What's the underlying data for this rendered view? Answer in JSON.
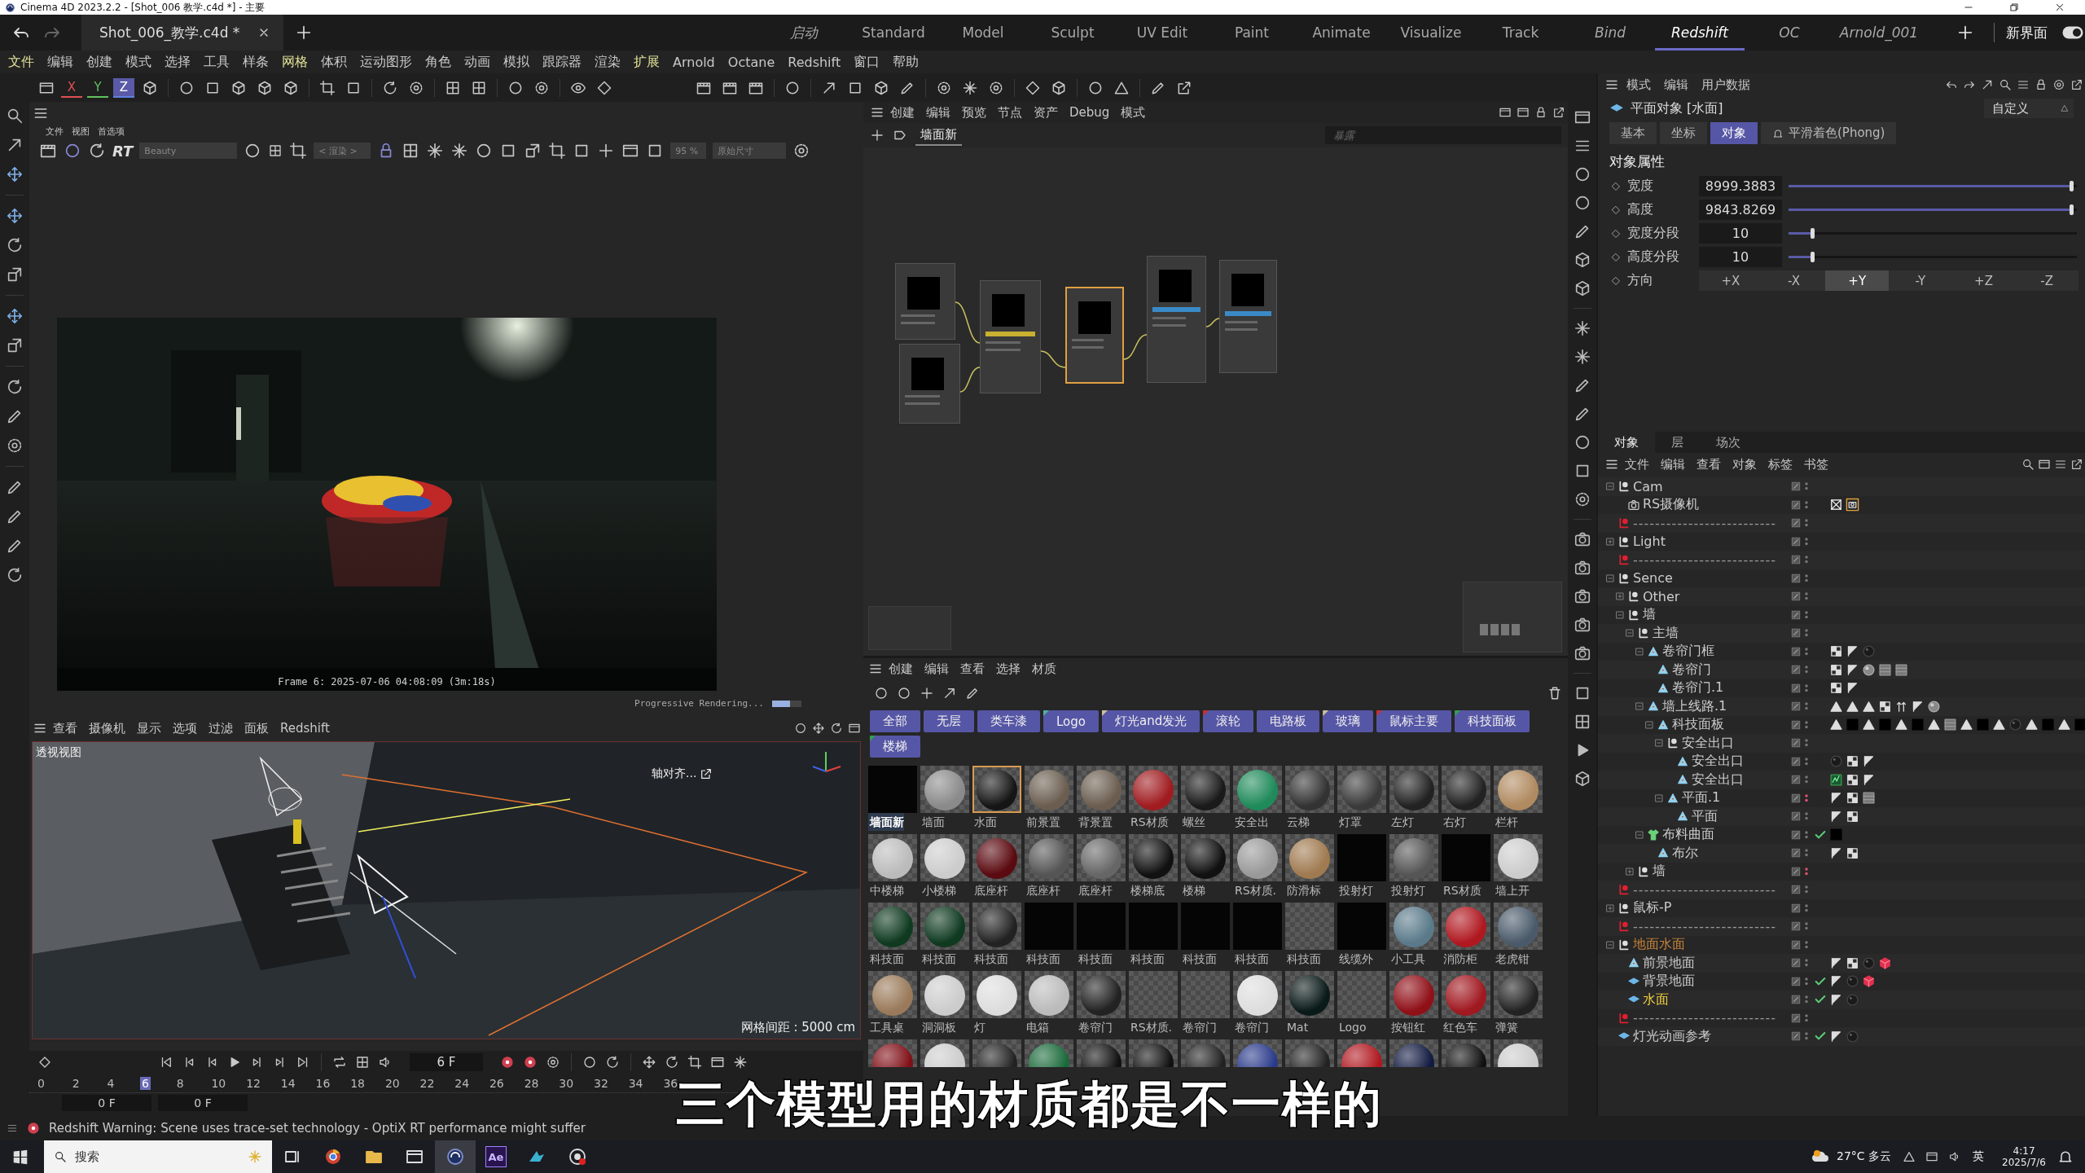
{
  "title_bar": {
    "title": "Cinema 4D 2023.2.2 - [Shot_006 教学.c4d *] - 主要"
  },
  "document_tab": {
    "label": "Shot_006_教学.c4d *"
  },
  "layouts": [
    {
      "label": "启动",
      "custom": true,
      "selected": false
    },
    {
      "label": "Standard",
      "custom": false,
      "selected": false
    },
    {
      "label": "Model",
      "custom": false,
      "selected": false
    },
    {
      "label": "Sculpt",
      "custom": false,
      "selected": false
    },
    {
      "label": "UV Edit",
      "custom": false,
      "selected": false
    },
    {
      "label": "Paint",
      "custom": false,
      "selected": false
    },
    {
      "label": "Animate",
      "custom": false,
      "selected": false
    },
    {
      "label": "Visualize",
      "custom": false,
      "selected": false
    },
    {
      "label": "Track",
      "custom": false,
      "selected": false
    },
    {
      "label": "Bind",
      "custom": true,
      "selected": false
    },
    {
      "label": "Redshift",
      "custom": true,
      "selected": true
    },
    {
      "label": "OC",
      "custom": true,
      "selected": false
    },
    {
      "label": "Arnold_001",
      "custom": true,
      "selected": false
    }
  ],
  "new_layout": "新界面",
  "menu": [
    {
      "label": "文件",
      "highlighted": true
    },
    {
      "label": "编辑",
      "highlighted": false
    },
    {
      "label": "创建",
      "highlighted": false
    },
    {
      "label": "模式",
      "highlighted": false
    },
    {
      "label": "选择",
      "highlighted": false
    },
    {
      "label": "工具",
      "highlighted": false
    },
    {
      "label": "样条",
      "highlighted": false
    },
    {
      "label": "网格",
      "highlighted": true
    },
    {
      "label": "体积",
      "highlighted": false
    },
    {
      "label": "运动图形",
      "highlighted": false
    },
    {
      "label": "角色",
      "highlighted": false
    },
    {
      "label": "动画",
      "highlighted": false
    },
    {
      "label": "模拟",
      "highlighted": false
    },
    {
      "label": "跟踪器",
      "highlighted": false
    },
    {
      "label": "渲染",
      "highlighted": false
    },
    {
      "label": "扩展",
      "highlighted": true
    },
    {
      "label": "Arnold",
      "highlighted": false
    },
    {
      "label": "Octane",
      "highlighted": false
    },
    {
      "label": "Redshift",
      "highlighted": false
    },
    {
      "label": "窗口",
      "highlighted": false
    },
    {
      "label": "帮助",
      "highlighted": false
    }
  ],
  "axis_buttons": [
    {
      "label": "X",
      "selected": false
    },
    {
      "label": "Y",
      "selected": false
    },
    {
      "label": "Z",
      "selected": true
    }
  ],
  "render_view": {
    "menu": [
      "文件",
      "视图",
      "首选项"
    ],
    "rt": "RT",
    "pass": "Beauty",
    "mode": "< 渲染 >",
    "zoom": "95 %",
    "size": "原始尺寸",
    "caption": "Frame 6: 2025-07-06 04:08:09 (3m:18s)",
    "progress_text": "Progressive Rendering...",
    "progress": {
      "level": 0.6
    }
  },
  "viewport": {
    "menu": [
      "查看",
      "摄像机",
      "显示",
      "选项",
      "过滤",
      "面板",
      "Redshift"
    ],
    "view_name": "透视视图",
    "align": "轴对齐...",
    "grid_spacing": "网格间距 : 5000 cm"
  },
  "timeline": {
    "current_frame": "6 F",
    "ruler": [
      {
        "label": "0",
        "selected": false
      },
      {
        "label": "2",
        "selected": false
      },
      {
        "label": "4",
        "selected": false
      },
      {
        "label": "6",
        "selected": true
      },
      {
        "label": "8",
        "selected": false
      },
      {
        "label": "10",
        "selected": false
      },
      {
        "label": "12",
        "selected": false
      },
      {
        "label": "14",
        "selected": false
      },
      {
        "label": "16",
        "selected": false
      },
      {
        "label": "18",
        "selected": false
      },
      {
        "label": "20",
        "selected": false
      },
      {
        "label": "22",
        "selected": false
      },
      {
        "label": "24",
        "selected": false
      },
      {
        "label": "26",
        "selected": false
      },
      {
        "label": "28",
        "selected": false
      },
      {
        "label": "30",
        "selected": false
      },
      {
        "label": "32",
        "selected": false
      },
      {
        "label": "34",
        "selected": false
      },
      {
        "label": "36",
        "selected": false
      }
    ],
    "start": "0 F",
    "end": "0 F"
  },
  "node_editor": {
    "menu": [
      "创建",
      "编辑",
      "预览",
      "节点",
      "资产",
      "Debug",
      "模式"
    ],
    "tab": "墙面新",
    "search": {
      "placeholder": "暴露"
    },
    "nodes": [
      {
        "selected": false
      },
      {
        "selected": false
      },
      {
        "selected": false,
        "color": "#c8b030"
      },
      {
        "selected": true
      },
      {
        "selected": false,
        "color": "#3a8ac8"
      },
      {
        "selected": false,
        "color": "#3a8ac8"
      }
    ]
  },
  "material_manager": {
    "menu": [
      "创建",
      "编辑",
      "查看",
      "选择",
      "材质"
    ],
    "tags": [
      {
        "label": "全部"
      },
      {
        "label": "无层"
      },
      {
        "label": "类车漆"
      },
      {
        "label": "Logo",
        "color": "#4fb0a0"
      },
      {
        "label": "灯光and发光",
        "color": "#c8c0a0"
      },
      {
        "label": "滚轮",
        "color": "#c83030"
      },
      {
        "label": "电路板"
      },
      {
        "label": "玻璃",
        "color": "#c8c0a0"
      },
      {
        "label": "鼠标主要",
        "color": "#c83030"
      },
      {
        "label": "科技面板",
        "color": "#30a050"
      },
      {
        "label": "楼梯",
        "color": "#30a050"
      }
    ],
    "materials": [
      {
        "label": "墙面新",
        "kind": "flat",
        "selected": false,
        "active": true
      },
      {
        "label": "墙面",
        "kind": "sphere",
        "color": "#8a8a8a",
        "selected": false,
        "active": false
      },
      {
        "label": "水面",
        "kind": "sphere",
        "color": "#151515",
        "selected": true,
        "active": false
      },
      {
        "label": "前景置",
        "kind": "sphere",
        "color": "#6b5e50",
        "selected": false,
        "active": false
      },
      {
        "label": "背景置",
        "kind": "sphere",
        "color": "#6b5e50",
        "selected": false,
        "active": false
      },
      {
        "label": "RS材质",
        "kind": "sphere",
        "color": "#a01c20",
        "selected": false,
        "active": false
      },
      {
        "label": "螺丝",
        "kind": "sphere",
        "color": "#1a1a1a",
        "selected": false,
        "active": false
      },
      {
        "label": "安全出",
        "kind": "sphere",
        "color": "#1f8a5a",
        "selected": false,
        "active": false
      },
      {
        "label": "云梯",
        "kind": "sphere",
        "color": "#333333",
        "selected": false,
        "active": false
      },
      {
        "label": "灯罩",
        "kind": "sphere",
        "color": "#3a3a3a",
        "selected": false,
        "active": false
      },
      {
        "label": "左灯",
        "kind": "sphere",
        "color": "#222222",
        "selected": false,
        "active": false
      },
      {
        "label": "右灯",
        "kind": "sphere",
        "color": "#222222",
        "selected": false,
        "active": false
      },
      {
        "label": "栏杆",
        "kind": "sphere",
        "color": "#b08a60",
        "selected": false,
        "active": false
      },
      {
        "label": "中楼梯",
        "kind": "sphere",
        "color": "#bbbbbb",
        "selected": false,
        "active": false
      },
      {
        "label": "小楼梯",
        "kind": "sphere",
        "color": "#cccccc",
        "selected": false,
        "active": false
      },
      {
        "label": "底座杆",
        "kind": "sphere",
        "color": "#5a0a10",
        "selected": false,
        "active": false
      },
      {
        "label": "底座杆",
        "kind": "sphere",
        "color": "#555555",
        "selected": false,
        "active": false
      },
      {
        "label": "底座杆",
        "kind": "sphere",
        "color": "#666666",
        "selected": false,
        "active": false
      },
      {
        "label": "楼梯底",
        "kind": "sphere",
        "color": "#111111",
        "selected": false,
        "active": false
      },
      {
        "label": "楼梯",
        "kind": "sphere",
        "color": "#111111",
        "selected": false,
        "active": false
      },
      {
        "label": "RS材质.",
        "kind": "sphere",
        "color": "#999999",
        "selected": false,
        "active": false
      },
      {
        "label": "防滑标",
        "kind": "sphere",
        "color": "#a07a50",
        "selected": false,
        "active": false
      },
      {
        "label": "投射灯",
        "kind": "flat",
        "selected": false,
        "active": false
      },
      {
        "label": "投射灯",
        "kind": "sphere",
        "color": "#555555",
        "selected": false,
        "active": false
      },
      {
        "label": "RS材质",
        "kind": "flat",
        "selected": false,
        "active": false
      },
      {
        "label": "墙上开",
        "kind": "sphere",
        "color": "#cccccc",
        "selected": false,
        "active": false
      },
      {
        "label": "科技面",
        "kind": "sphere",
        "color": "#0f3a20",
        "selected": false,
        "active": false
      },
      {
        "label": "科技面",
        "kind": "sphere",
        "color": "#0f3a20",
        "selected": false,
        "active": false
      },
      {
        "label": "科技面",
        "kind": "sphere",
        "color": "#222222",
        "selected": false,
        "active": false
      },
      {
        "label": "科技面",
        "kind": "flat",
        "selected": false,
        "active": false
      },
      {
        "label": "科技面",
        "kind": "flat",
        "selected": false,
        "active": false
      },
      {
        "label": "科技面",
        "kind": "flat",
        "selected": false,
        "active": false
      },
      {
        "label": "科技面",
        "kind": "flat",
        "selected": false,
        "active": false
      },
      {
        "label": "科技面",
        "kind": "flat",
        "selected": false,
        "active": false
      },
      {
        "label": "科技面",
        "kind": "empty",
        "selected": false,
        "active": false
      },
      {
        "label": "线缆外",
        "kind": "flat",
        "selected": false,
        "active": false
      },
      {
        "label": "小工具",
        "kind": "sphere",
        "color": "#5a7a8a",
        "selected": false,
        "active": false
      },
      {
        "label": "消防柜",
        "kind": "sphere",
        "color": "#b01820",
        "selected": false,
        "active": false
      },
      {
        "label": "老虎钳",
        "kind": "sphere",
        "color": "#4a5a6a",
        "selected": false,
        "active": false
      },
      {
        "label": "工具桌",
        "kind": "sphere",
        "color": "#9a7a5a",
        "selected": false,
        "active": false
      },
      {
        "label": "洞洞板",
        "kind": "sphere",
        "color": "#cccccc",
        "selected": false,
        "active": false
      },
      {
        "label": "灯",
        "kind": "sphere",
        "color": "#dddddd",
        "selected": false,
        "active": false
      },
      {
        "label": "电箱",
        "kind": "sphere",
        "color": "#bbbbbb",
        "selected": false,
        "active": false
      },
      {
        "label": "卷帘门",
        "kind": "sphere",
        "color": "#222222",
        "selected": false,
        "active": false
      },
      {
        "label": "RS材质.",
        "kind": "empty",
        "selected": false,
        "active": false
      },
      {
        "label": "卷帘门",
        "kind": "empty",
        "selected": false,
        "active": false
      },
      {
        "label": "卷帘门",
        "kind": "sphere",
        "color": "#dddddd",
        "selected": false,
        "active": false
      },
      {
        "label": "Mat",
        "kind": "sphere",
        "color": "#0a1a18",
        "selected": false,
        "active": false
      },
      {
        "label": "Logo",
        "kind": "empty",
        "selected": false,
        "active": false
      },
      {
        "label": "按钮红",
        "kind": "sphere",
        "color": "#901018",
        "selected": false,
        "active": false
      },
      {
        "label": "红色车",
        "kind": "sphere",
        "color": "#a01820",
        "selected": false,
        "active": false
      },
      {
        "label": "弹簧",
        "kind": "sphere",
        "color": "#222222",
        "selected": false,
        "active": false
      },
      {
        "kind": "sphere",
        "color": "#801018",
        "selected": false
      },
      {
        "kind": "sphere",
        "color": "#cccccc",
        "selected": false
      },
      {
        "kind": "sphere",
        "color": "#222222",
        "selected": false
      },
      {
        "kind": "sphere",
        "color": "#1a6a3a",
        "selected": false
      },
      {
        "kind": "sphere",
        "color": "#111111",
        "selected": false
      },
      {
        "kind": "sphere",
        "color": "#111111",
        "selected": false
      },
      {
        "kind": "sphere",
        "color": "#222222",
        "selected": false
      },
      {
        "kind": "sphere",
        "color": "#2a3a8a",
        "selected": false
      },
      {
        "kind": "sphere",
        "color": "#222222",
        "selected": false
      },
      {
        "kind": "sphere",
        "color": "#b01820",
        "selected": false
      },
      {
        "kind": "sphere",
        "color": "#111a40",
        "selected": false
      },
      {
        "kind": "sphere",
        "color": "#111111",
        "selected": false
      },
      {
        "kind": "sphere",
        "color": "#cccccc",
        "selected": false
      }
    ]
  },
  "attributes": {
    "menu": [
      "模式",
      "编辑",
      "用户数据"
    ],
    "object": "平面对象 [水面]",
    "preset": "自定义",
    "tabs": [
      {
        "label": "基本",
        "selected": false
      },
      {
        "label": "坐标",
        "selected": false
      },
      {
        "label": "对象",
        "selected": true
      },
      {
        "label": "平滑着色(Phong)",
        "selected": false
      }
    ],
    "section": "对象属性",
    "fields": [
      {
        "label": "宽度",
        "value": "8999.3883",
        "level": 0.99
      },
      {
        "label": "高度",
        "value": "9843.8269",
        "level": 0.99
      },
      {
        "label": "宽度分段",
        "value": "10",
        "level": 0.09
      },
      {
        "label": "高度分段",
        "value": "10",
        "level": 0.09
      }
    ],
    "direction": {
      "label": "方向",
      "options": [
        {
          "label": "+X",
          "selected": false
        },
        {
          "label": "-X",
          "selected": false
        },
        {
          "label": "+Y",
          "selected": true
        },
        {
          "label": "-Y",
          "selected": false
        },
        {
          "label": "+Z",
          "selected": false
        },
        {
          "label": "-Z",
          "selected": false
        }
      ]
    }
  },
  "object_manager": {
    "tabs": [
      {
        "label": "对象",
        "selected": true
      },
      {
        "label": "层",
        "selected": false
      },
      {
        "label": "场次",
        "selected": false
      }
    ],
    "menu": [
      "文件",
      "编辑",
      "查看",
      "对象",
      "标签",
      "书签"
    ],
    "tree": [
      {
        "name": "Cam",
        "kind": "null",
        "expanded": true,
        "checked": false,
        "selected": false,
        "render_off": false,
        "children": [
          {
            "name": "RS摄像机",
            "kind": "camera",
            "checked": false,
            "selected": false,
            "render_off": false,
            "tags": [
              {
                "kind": "target"
              },
              {
                "kind": "cam"
              }
            ]
          }
        ]
      },
      {
        "name": "--------------------------",
        "kind": "separator",
        "checked": false,
        "selected": false,
        "render_off": false
      },
      {
        "name": "Light",
        "kind": "null",
        "expanded": false,
        "checked": false,
        "selected": false,
        "render_off": false
      },
      {
        "name": "--------------------------",
        "kind": "separator",
        "checked": false,
        "selected": false,
        "render_off": false
      },
      {
        "name": "Sence",
        "kind": "null",
        "expanded": true,
        "checked": false,
        "selected": false,
        "render_off": false,
        "children": [
          {
            "name": "Other",
            "kind": "null",
            "expanded": false,
            "checked": false,
            "selected": false,
            "render_off": false
          },
          {
            "name": "墙",
            "kind": "null",
            "expanded": true,
            "checked": false,
            "selected": false,
            "render_off": false,
            "children": [
              {
                "name": "主墙",
                "kind": "null",
                "expanded": true,
                "checked": false,
                "selected": false,
                "render_off": false,
                "children": [
                  {
                    "name": "卷帘门框",
                    "kind": "poly",
                    "expanded": true,
                    "checked": false,
                    "selected": false,
                    "render_off": false,
                    "tags": [
                      {
                        "kind": "checker"
                      },
                      {
                        "kind": "phong"
                      },
                      {
                        "kind": "sphere_dark"
                      }
                    ],
                    "children": [
                      {
                        "name": "卷帘门",
                        "kind": "poly",
                        "checked": false,
                        "selected": false,
                        "render_off": false,
                        "tags": [
                          {
                            "kind": "checker"
                          },
                          {
                            "kind": "phong"
                          },
                          {
                            "kind": "sphere_grey"
                          },
                          {
                            "kind": "texture"
                          },
                          {
                            "kind": "texture"
                          }
                        ]
                      },
                      {
                        "name": "卷帘门.1",
                        "kind": "poly",
                        "checked": false,
                        "selected": false,
                        "render_off": false,
                        "tags": [
                          {
                            "kind": "checker"
                          },
                          {
                            "kind": "phong"
                          }
                        ]
                      }
                    ]
                  },
                  {
                    "name": "墙上线路.1",
                    "kind": "poly",
                    "expanded": true,
                    "checked": false,
                    "selected": false,
                    "render_off": false,
                    "tags": [
                      {
                        "kind": "triangle"
                      },
                      {
                        "kind": "triangle"
                      },
                      {
                        "kind": "triangle"
                      },
                      {
                        "kind": "checker"
                      },
                      {
                        "kind": "updown"
                      },
                      {
                        "kind": "phong"
                      },
                      {
                        "kind": "sphere_grey"
                      }
                    ],
                    "children": [
                      {
                        "name": "科技面板",
                        "kind": "poly",
                        "expanded": true,
                        "checked": false,
                        "selected": false,
                        "render_off": false,
                        "tags": [
                          {
                            "kind": "triangle"
                          },
                          {
                            "kind": "black"
                          },
                          {
                            "kind": "triangle"
                          },
                          {
                            "kind": "black"
                          },
                          {
                            "kind": "triangle"
                          },
                          {
                            "kind": "black"
                          },
                          {
                            "kind": "triangle"
                          },
                          {
                            "kind": "texture"
                          },
                          {
                            "kind": "triangle"
                          },
                          {
                            "kind": "black"
                          },
                          {
                            "kind": "triangle"
                          },
                          {
                            "kind": "sphere_dark"
                          },
                          {
                            "kind": "triangle"
                          },
                          {
                            "kind": "black"
                          },
                          {
                            "kind": "triangle"
                          },
                          {
                            "kind": "black"
                          }
                        ],
                        "children": [
                          {
                            "name": "安全出口",
                            "kind": "null",
                            "expanded": true,
                            "checked": false,
                            "selected": false,
                            "render_off": false,
                            "children": [
                              {
                                "name": "安全出口",
                                "kind": "poly",
                                "checked": false,
                                "selected": false,
                                "render_off": false,
                                "tags": [
                                  {
                                    "kind": "sphere_dark"
                                  },
                                  {
                                    "kind": "checker"
                                  },
                                  {
                                    "kind": "phong"
                                  }
                                ]
                              },
                              {
                                "name": "安全出口",
                                "kind": "poly",
                                "checked": false,
                                "selected": false,
                                "render_off": false,
                                "tags": [
                                  {
                                    "kind": "green"
                                  },
                                  {
                                    "kind": "checker"
                                  },
                                  {
                                    "kind": "phong"
                                  }
                                ]
                              }
                            ]
                          },
                          {
                            "name": "平面.1",
                            "kind": "poly",
                            "expanded": true,
                            "checked": false,
                            "selected": false,
                            "render_off": true,
                            "tags": [
                              {
                                "kind": "phong"
                              },
                              {
                                "kind": "checker"
                              },
                              {
                                "kind": "texture"
                              }
                            ],
                            "children": [
                              {
                                "name": "平面",
                                "kind": "poly",
                                "checked": false,
                                "selected": false,
                                "render_off": false,
                                "tags": [
                                  {
                                    "kind": "phong"
                                  },
                                  {
                                    "kind": "checker"
                                  }
                                ]
                              }
                            ]
                          }
                        ]
                      }
                    ]
                  },
                  {
                    "name": "布料曲面",
                    "kind": "cloth",
                    "expanded": true,
                    "checked": true,
                    "selected": false,
                    "render_off": false,
                    "tags": [
                      {
                        "kind": "black"
                      }
                    ],
                    "children": [
                      {
                        "name": "布尔",
                        "kind": "poly",
                        "checked": false,
                        "selected": false,
                        "render_off": false,
                        "tags": [
                          {
                            "kind": "phong"
                          },
                          {
                            "kind": "checker"
                          }
                        ]
                      }
                    ]
                  }
                ]
              },
              {
                "name": "墙",
                "kind": "null",
                "expanded": false,
                "checked": false,
                "selected": false,
                "render_off": true
              }
            ]
          }
        ]
      },
      {
        "name": "--------------------------",
        "kind": "separator",
        "checked": false,
        "selected": false,
        "render_off": false
      },
      {
        "name": "鼠标-P",
        "kind": "null",
        "expanded": false,
        "checked": false,
        "selected": false,
        "render_off": false
      },
      {
        "name": "--------------------------",
        "kind": "separator",
        "checked": false,
        "selected": false,
        "render_off": false
      },
      {
        "name": "地面水面",
        "kind": "null",
        "expanded": true,
        "color": "#c8843a",
        "checked": false,
        "selected": false,
        "render_off": false,
        "children": [
          {
            "name": "前景地面",
            "kind": "poly",
            "checked": false,
            "selected": false,
            "render_off": false,
            "tags": [
              {
                "kind": "phong"
              },
              {
                "kind": "checker"
              },
              {
                "kind": "sphere_dark"
              },
              {
                "kind": "redcube"
              }
            ]
          },
          {
            "name": "背景地面",
            "kind": "plane",
            "checked": true,
            "selected": false,
            "render_off": false,
            "tags": [
              {
                "kind": "phong"
              },
              {
                "kind": "sphere_dark"
              },
              {
                "kind": "redcube"
              }
            ]
          },
          {
            "name": "水面",
            "kind": "plane",
            "checked": true,
            "selected": true,
            "render_off": false,
            "tags": [
              {
                "kind": "phong"
              },
              {
                "kind": "sphere_dark"
              }
            ]
          }
        ]
      },
      {
        "name": "--------------------------",
        "kind": "separator",
        "checked": false,
        "selected": false,
        "render_off": false
      },
      {
        "name": "灯光动画参考",
        "kind": "plane",
        "checked": true,
        "selected": false,
        "render_off": false,
        "tags": [
          {
            "kind": "phong"
          },
          {
            "kind": "sphere_dark"
          }
        ]
      }
    ]
  },
  "status_bar": {
    "message": "Redshift Warning: Scene uses trace-set technology - OptiX RT performance might suffer"
  },
  "taskbar": {
    "search": {
      "placeholder": "搜索"
    },
    "apps": [
      {
        "kind": "taskview",
        "active": false
      },
      {
        "kind": "browser",
        "active": false
      },
      {
        "kind": "folder",
        "active": false
      },
      {
        "kind": "window",
        "active": false
      },
      {
        "kind": "sphere",
        "active": true
      },
      {
        "kind": "text",
        "label": "Ae",
        "active": false
      },
      {
        "kind": "wing",
        "active": false
      },
      {
        "kind": "record",
        "active": false
      }
    ],
    "weather": "27°C 多云",
    "ime": "英",
    "time": "4:17",
    "date": "2025/7/6"
  },
  "subtitle": "三个模型用的材质都是不一样的"
}
